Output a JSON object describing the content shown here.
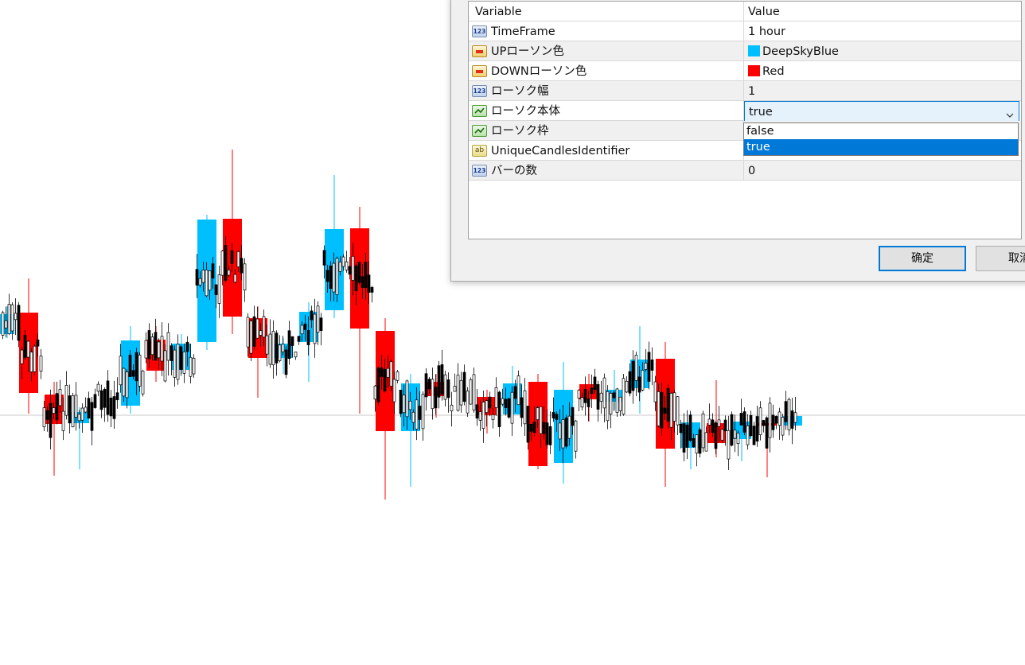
{
  "chart": {
    "up_color": "#00BFFF",
    "down_color": "#FF0000",
    "wick_color": "#000000"
  },
  "dialog": {
    "columns": {
      "variable": "Variable",
      "value": "Value"
    },
    "params": [
      {
        "icon": "integer-icon",
        "icon_text": "123",
        "name": "TimeFrame",
        "value": "1 hour"
      },
      {
        "icon": "color-icon",
        "icon_text": "",
        "name": "UPローソン色",
        "value": "DeepSkyBlue",
        "swatch": "#00BFFF"
      },
      {
        "icon": "color-icon",
        "icon_text": "",
        "name": "DOWNローソン色",
        "value": "Red",
        "swatch": "#FF0000"
      },
      {
        "icon": "integer-icon",
        "icon_text": "123",
        "name": "ローソク幅",
        "value": "1"
      },
      {
        "icon": "boolean-icon",
        "icon_text": "",
        "name": "ローソク本体",
        "value": "true"
      },
      {
        "icon": "boolean-icon",
        "icon_text": "",
        "name": "ローソク枠",
        "value": ""
      },
      {
        "icon": "string-icon",
        "icon_text": "ab",
        "name": "UniqueCandlesIdentifier",
        "value": ""
      },
      {
        "icon": "integer-icon",
        "icon_text": "123",
        "name": "バーの数",
        "value": "0"
      }
    ],
    "dropdown_options": [
      "false",
      "true"
    ],
    "dropdown_selected": "true",
    "ok_label": "确定",
    "cancel_label": "取消"
  }
}
